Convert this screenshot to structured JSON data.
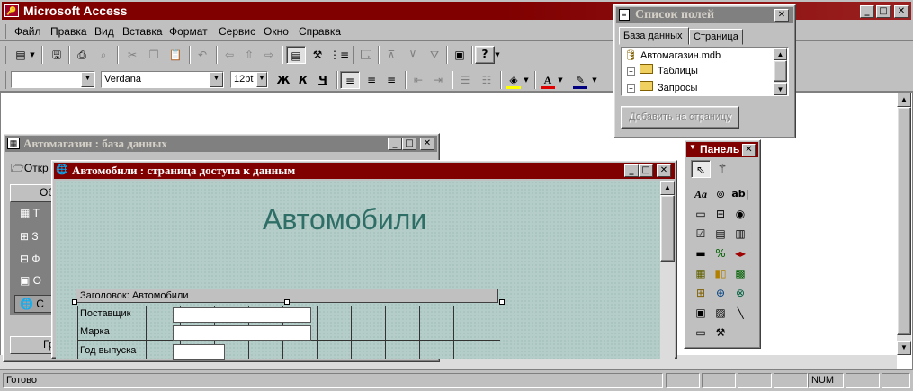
{
  "app": {
    "title": "Microsoft Access",
    "colors": {
      "active_title": "#800000",
      "inactive_title": "#808080",
      "page_bg": "#b4cdc8",
      "heading": "#2e6e66"
    }
  },
  "menu": [
    "Файл",
    "Правка",
    "Вид",
    "Вставка",
    "Формат",
    "Сервис",
    "Окно",
    "Справка"
  ],
  "toolbar": {
    "font_name": "Verdana",
    "font_size": "12pt",
    "style_combo": "",
    "bold": "Ж",
    "italic": "К",
    "underline": "Ч"
  },
  "db_window": {
    "title": "Автомагазин : база данных",
    "open_label": "Откр",
    "tab_label": "Об",
    "group_label": "Гр",
    "object_letters": [
      "Т",
      "З",
      "Ф",
      "О",
      "С"
    ]
  },
  "page_window": {
    "title": "Автомобили : страница доступа к данным",
    "heading": "Автомобили",
    "section_header": "Заголовок: Автомобили",
    "fields": [
      "Поставщик",
      "Марка",
      "Год выпуска"
    ]
  },
  "field_list": {
    "title": "Список полей",
    "tabs": [
      "База данных",
      "Страница"
    ],
    "tree": [
      "Автомагазин.mdb",
      "Таблицы",
      "Запросы"
    ],
    "add_button": "Добавить на страницу"
  },
  "toolbox": {
    "title": "Панель",
    "tools": [
      "pointer",
      "wizard",
      "label",
      "bound-html",
      "textbox",
      "scrolling-text",
      "expand",
      "option-button",
      "checkbox",
      "dropdown",
      "listbox",
      "command-button",
      "hyperlink",
      "navigation",
      "image-hyperlink",
      "office-chart",
      "office-spreadsheet",
      "office-pivottable",
      "movie",
      "picture",
      "line",
      "rectangle",
      "more-tools"
    ]
  },
  "status": {
    "text": "Готово",
    "num": "NUM"
  }
}
